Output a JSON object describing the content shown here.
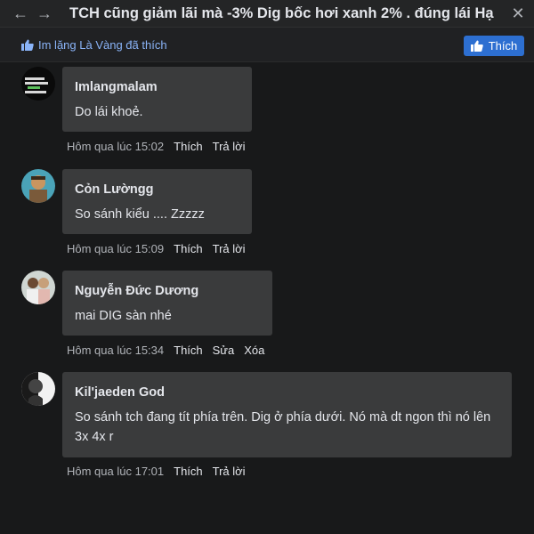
{
  "title": "TCH cũng giảm lãi mà -3% Dig bốc hơi xanh 2% . đúng lái Hạ",
  "liked_by": "Im lặng Là Vàng đã thích",
  "like_button": "Thích",
  "comments": [
    {
      "author": "Imlangmalam",
      "text": "Do lái khoẻ.",
      "time": "Hôm qua lúc 15:02",
      "actions": [
        "Thích",
        "Trả lời"
      ]
    },
    {
      "author": "Cỏn Lườngg",
      "text": "So sánh kiểu .... Zzzzz",
      "time": "Hôm qua lúc 15:09",
      "actions": [
        "Thích",
        "Trả lời"
      ]
    },
    {
      "author": "Nguyễn Đức Dương",
      "text": "mai DIG sàn nhé",
      "time": "Hôm qua lúc 15:34",
      "actions": [
        "Thích",
        "Sửa",
        "Xóa"
      ]
    },
    {
      "author": "Kil'jaeden God",
      "text": "So sánh tch đang tít phía trên. Dig ở phía dưới. Nó mà dt ngon thì nó lên 3x 4x r",
      "time": "Hôm qua lúc 17:01",
      "actions": [
        "Thích",
        "Trả lời"
      ]
    }
  ],
  "colors": {
    "background": "#18191a",
    "bubble": "#3a3b3c",
    "accent": "#2d6fd1",
    "link": "#8ab4f8"
  }
}
